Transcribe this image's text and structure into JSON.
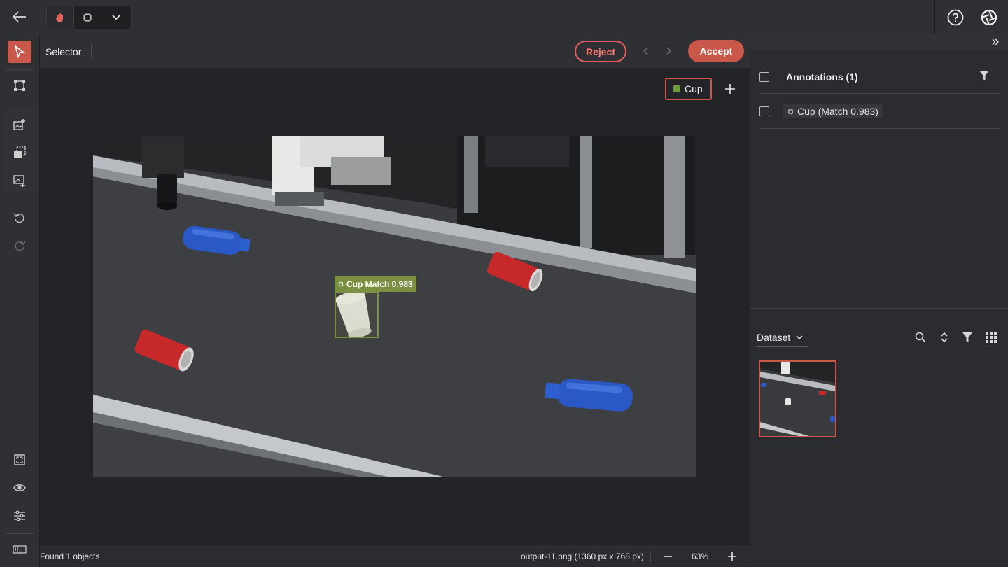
{
  "toolbar": {
    "mode_items": [
      "hand-icon",
      "chip-icon",
      "chevron-down-icon"
    ],
    "right_icons": [
      "help-icon",
      "aperture-logo-icon"
    ]
  },
  "left_tools": [
    "selector-arrow-icon",
    "bounding-box-icon",
    "image-add-icon",
    "copy-icon",
    "image-edit-icon",
    "undo-icon",
    "redo-icon",
    "fit-screen-icon",
    "eye-icon",
    "sliders-icon",
    "keyboard-icon"
  ],
  "subbar": {
    "tool_name": "Selector",
    "reject_label": "Reject",
    "accept_label": "Accept"
  },
  "canvas": {
    "active_label": "Cup",
    "active_label_color": "#6f9a3c",
    "annotation_label": "Cup Match 0.983",
    "bbox_color": "#7a8f3f"
  },
  "status": {
    "found_text": "Found 1 objects",
    "file_info": "output-11.png (1360 px x 768 px)",
    "zoom": "63%"
  },
  "annotations_panel": {
    "title": "Annotations (1)",
    "items": [
      {
        "label": "Cup (Match 0.983)"
      }
    ]
  },
  "dataset_panel": {
    "title": "Dataset",
    "icons": [
      "search-icon",
      "sort-icon",
      "filter-icon",
      "grid-icon"
    ]
  },
  "colors": {
    "accent": "#c9574a",
    "reject": "#e0605a"
  }
}
